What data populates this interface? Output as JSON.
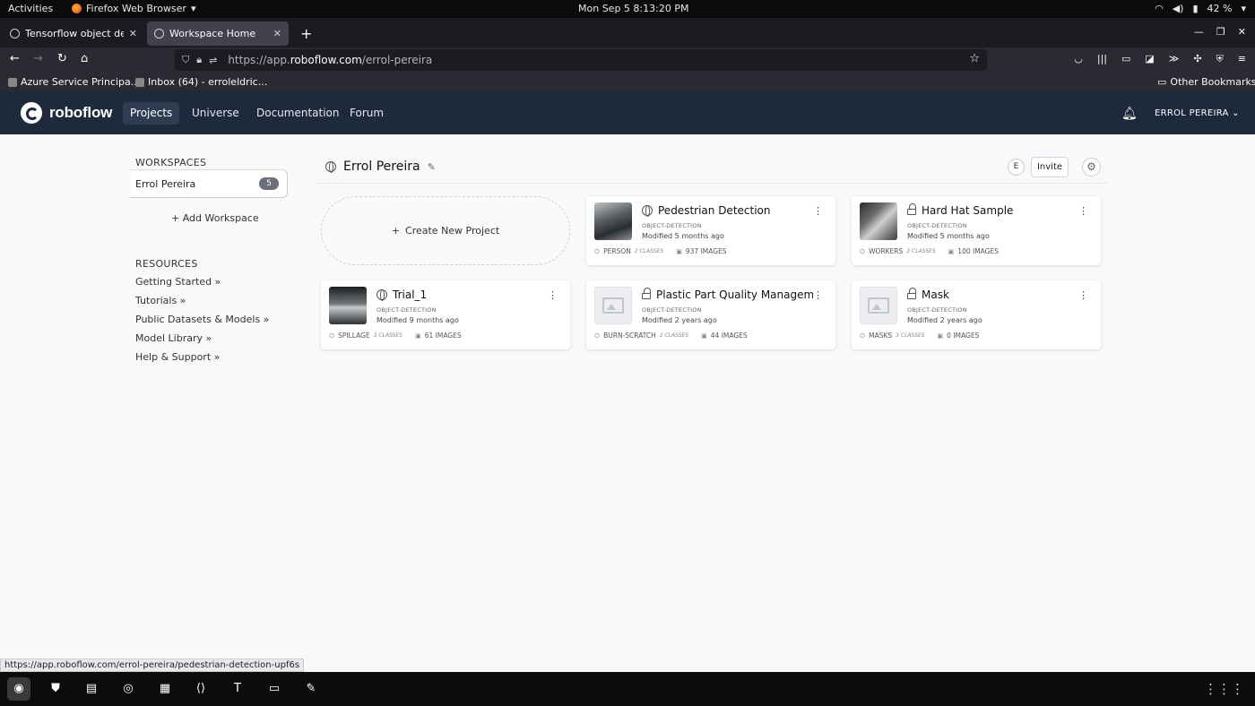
{
  "system": {
    "activities": "Activities",
    "app_name": "Firefox Web Browser",
    "clock": "Mon Sep 5   8:13:20 PM",
    "battery": "42 %"
  },
  "browser": {
    "tabs": [
      {
        "title": "Tensorflow object detect"
      },
      {
        "title": "Workspace Home"
      }
    ],
    "url_prefix": "https://app.",
    "url_domain": "roboflow.com",
    "url_path": "/errol-pereira",
    "bookmarks": [
      {
        "label": "Azure Service Principa..."
      },
      {
        "label": "Inbox (64) - erroleldric..."
      }
    ],
    "other_bookmarks": "Other Bookmarks",
    "status_url": "https://app.roboflow.com/errol-pereira/pedestrian-detection-upf6s"
  },
  "roboflow_nav": {
    "brand": "roboflow",
    "links": [
      "Projects",
      "Universe",
      "Documentation",
      "Forum"
    ],
    "user": "ERROL PEREIRA"
  },
  "sidebar": {
    "workspaces_heading": "WORKSPACES",
    "workspace_name": "Errol Pereira",
    "workspace_count": "5",
    "add_workspace": "+ Add Workspace",
    "resources_heading": "RESOURCES",
    "resources": [
      "Getting Started »",
      "Tutorials »",
      "Public Datasets & Models »",
      "Model Library »",
      "Help & Support »"
    ]
  },
  "header": {
    "workspace_title": "Errol Pereira",
    "member_initial": "E",
    "invite_label": "Invite"
  },
  "create_label": "Create New Project",
  "projects": [
    {
      "title": "Pedestrian Detection",
      "type": "OBJECT-DETECTION",
      "modified": "Modified 5 months ago",
      "tag": "PERSON",
      "classes": "2 CLASSES",
      "images": "937 IMAGES",
      "visibility": "public"
    },
    {
      "title": "Hard Hat Sample",
      "type": "OBJECT-DETECTION",
      "modified": "Modified 5 months ago",
      "tag": "WORKERS",
      "classes": "3 CLASSES",
      "images": "100 IMAGES",
      "visibility": "private"
    },
    {
      "title": "Trial_1",
      "type": "OBJECT-DETECTION",
      "modified": "Modified 9 months ago",
      "tag": "SPILLAGE",
      "classes": "3 CLASSES",
      "images": "61 IMAGES",
      "visibility": "public"
    },
    {
      "title": "Plastic Part Quality Managem...",
      "type": "OBJECT-DETECTION",
      "modified": "Modified 2 years ago",
      "tag": "BURN-SCRATCH",
      "classes": "2 CLASSES",
      "images": "44 IMAGES",
      "visibility": "private"
    },
    {
      "title": "Mask",
      "type": "OBJECT-DETECTION",
      "modified": "Modified 2 years ago",
      "tag": "MASKS",
      "classes": "3 CLASSES",
      "images": "0 IMAGES",
      "visibility": "private"
    }
  ]
}
